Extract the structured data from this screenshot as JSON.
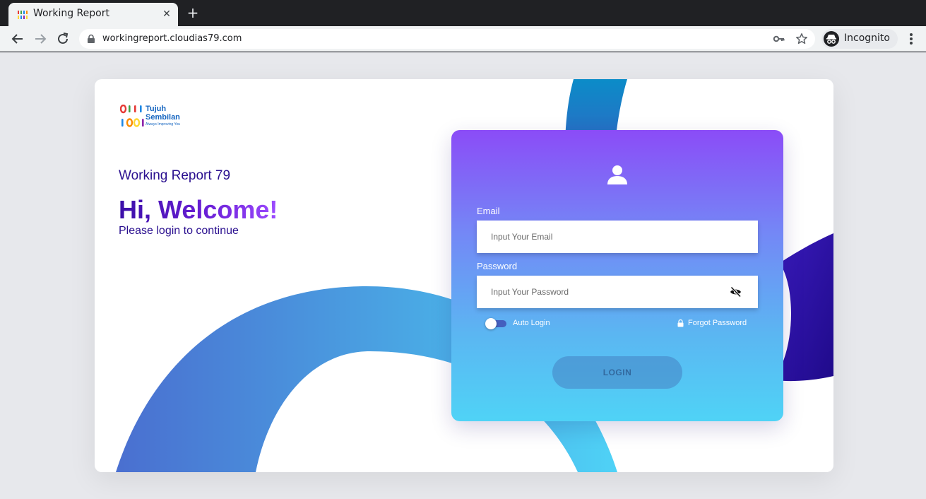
{
  "browser": {
    "tab_title": "Working Report",
    "url": "workingreport.cloudias79.com",
    "profile_label": "Incognito"
  },
  "logo": {
    "line1": "Tujuh",
    "line2": "Sembilan",
    "tagline": "Always Improving You"
  },
  "hero": {
    "app_title": "Working Report 79",
    "welcome": "Hi, Welcome!",
    "subtitle": "Please login to continue"
  },
  "login": {
    "email_label": "Email",
    "email_placeholder": "Input Your Email",
    "password_label": "Password",
    "password_placeholder": "Input Your Password",
    "auto_login_label": "Auto Login",
    "auto_login_on": false,
    "forgot_label": "Forgot Password",
    "button_label": "LOGIN"
  },
  "colors": {
    "panel_top": "#8b4cf7",
    "panel_bottom": "#4fd3f6",
    "title_purple": "#2a0f8f",
    "logo_blue": "#1565c0"
  }
}
